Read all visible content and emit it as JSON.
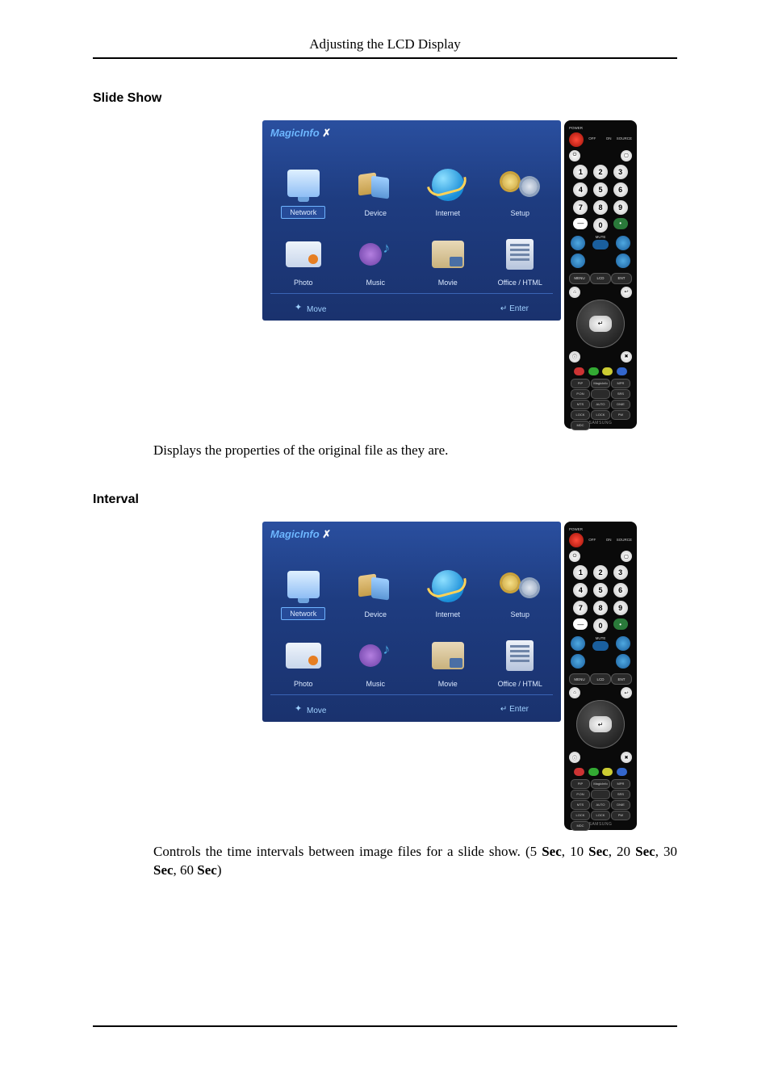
{
  "header": {
    "title": "Adjusting the LCD Display"
  },
  "sections": {
    "slideshow": {
      "heading": "Slide Show",
      "body_prefix": "Displays the properties of the original file as they are."
    },
    "interval": {
      "heading": "Interval",
      "body_plain": "Controls the time intervals between image files for a slide show. (5 Sec, 10 Sec, 20 Sec, 30 Sec, 60 Sec)"
    }
  },
  "interval_parts": {
    "p0": "Controls the time intervals between image files for a slide show. (5 ",
    "b0": "Sec",
    "p1": ", 10 ",
    "b1": "Sec",
    "p2": ", 20 ",
    "b2": "Sec",
    "p3": ", 30 ",
    "b3": "Sec",
    "p4": ", 60 ",
    "b4": "Sec",
    "p5": ")"
  },
  "tv": {
    "logo": "MagicInfo",
    "logo_x": "✗",
    "tiles": {
      "network": "Network",
      "device": "Device",
      "internet": "Internet",
      "setup": "Setup",
      "photo": "Photo",
      "music": "Music",
      "movie": "Movie",
      "office": "Office / HTML"
    },
    "bar": {
      "move": "Move",
      "enter": "Enter"
    }
  },
  "remote": {
    "power": "POWER",
    "source": "SOURCE",
    "off": "OFF",
    "on": "ON",
    "nums": {
      "n1": "1",
      "n2": "2",
      "n3": "3",
      "n4": "4",
      "n5": "5",
      "n6": "6",
      "n7": "7",
      "n8": "8",
      "n9": "9",
      "n0": "0",
      "dash": "—",
      "dot": "•"
    },
    "mute": "MUTE",
    "menu": "MENU",
    "lcd": "LCD",
    "ent": "ENT",
    "menu_side": "⌂",
    "return_side": "↩",
    "enter": "↵",
    "info": "ⓘ",
    "exit": "✖",
    "labels": {
      "pip": "PIP",
      "magicinfo": "MagicInfo",
      "mpr": "MPR",
      "pon": "P.ON",
      "blank": "",
      "srs": "SRS",
      "mts": "MTS",
      "auto": "AUTO",
      "dnie": "DNIE",
      "lock": "LOCK",
      "lock2": "LOCK",
      "pw": "PW",
      "mdc": "MDC"
    },
    "brand": "SAMSUNG"
  }
}
